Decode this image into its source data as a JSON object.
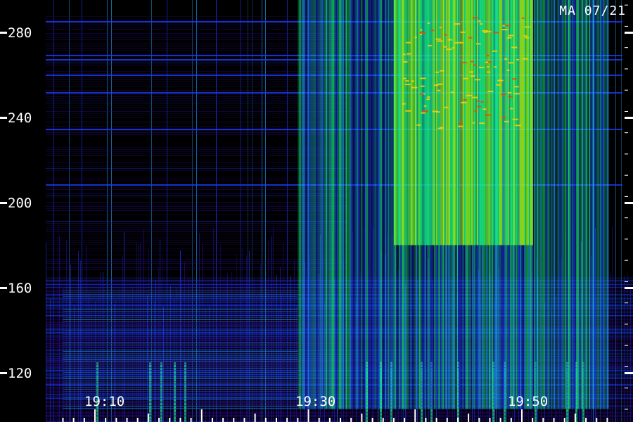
{
  "chart_data": {
    "type": "heatmap",
    "title": "MA 07/21",
    "y_ticks": [
      "280",
      "240",
      "200",
      "160",
      "120"
    ],
    "y_tick_values": [
      280,
      240,
      200,
      160,
      120
    ],
    "x_ticks": [
      "19:10",
      "19:30",
      "19:50"
    ],
    "x_tick_values": [
      "19:10",
      "19:30",
      "19:50"
    ],
    "ylim": [
      103,
      298
    ],
    "xlim": [
      "19:07",
      "19:58"
    ],
    "colormap": [
      "#000000",
      "#2a0a8a",
      "#1e3cff",
      "#1eb4ff",
      "#18ff7a",
      "#a8ff00",
      "#ffd000",
      "#ff4000"
    ],
    "regions": [
      {
        "t_start": "19:29",
        "t_end": "19:58",
        "f_low": 103,
        "f_high": 298,
        "intensity": "high"
      },
      {
        "t_start": "19:38",
        "t_end": "19:51",
        "f_low": 180,
        "f_high": 298,
        "intensity": "peak"
      },
      {
        "t_start": "19:07",
        "t_end": "19:29",
        "f_low": 103,
        "f_high": 160,
        "intensity": "moderate"
      }
    ]
  }
}
